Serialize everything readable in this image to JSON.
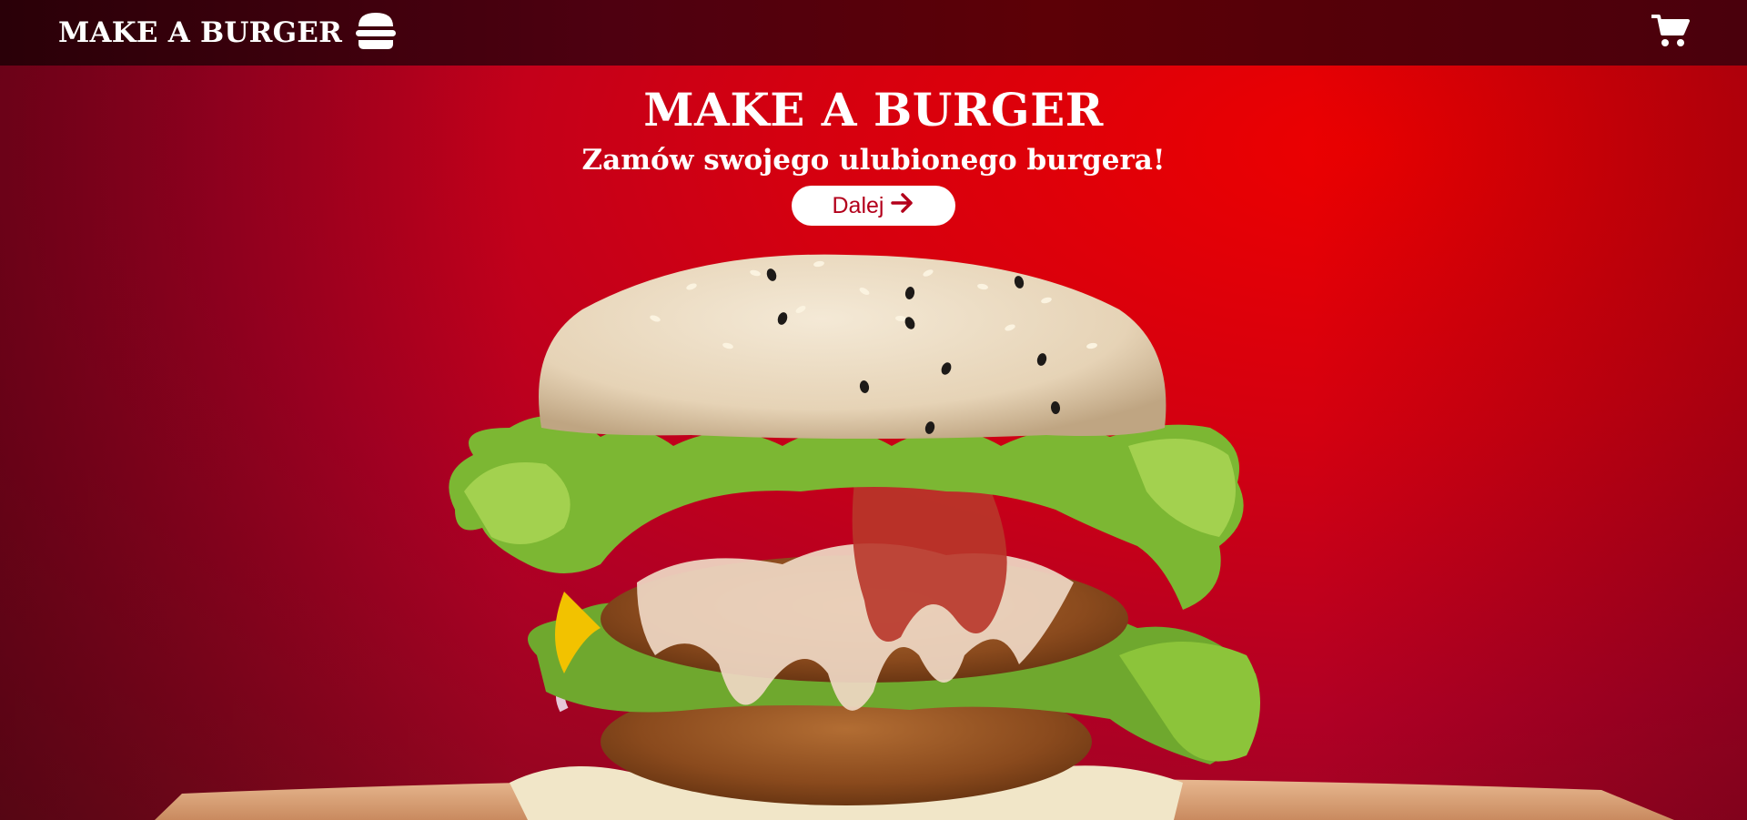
{
  "navbar": {
    "brand": "MAKE A BURGER",
    "brand_icon": "burger-icon",
    "cart_icon": "cart-icon"
  },
  "hero": {
    "title": "MAKE A BURGER",
    "subtitle": "Zamów swojego ulubionego burgera!",
    "button_label": "Dalej",
    "button_icon": "arrow-right-icon"
  },
  "background": {
    "image": "burger-photo",
    "colors": {
      "primary": "#e00010",
      "dark": "#4e0010",
      "accent": "#b3001b"
    }
  }
}
